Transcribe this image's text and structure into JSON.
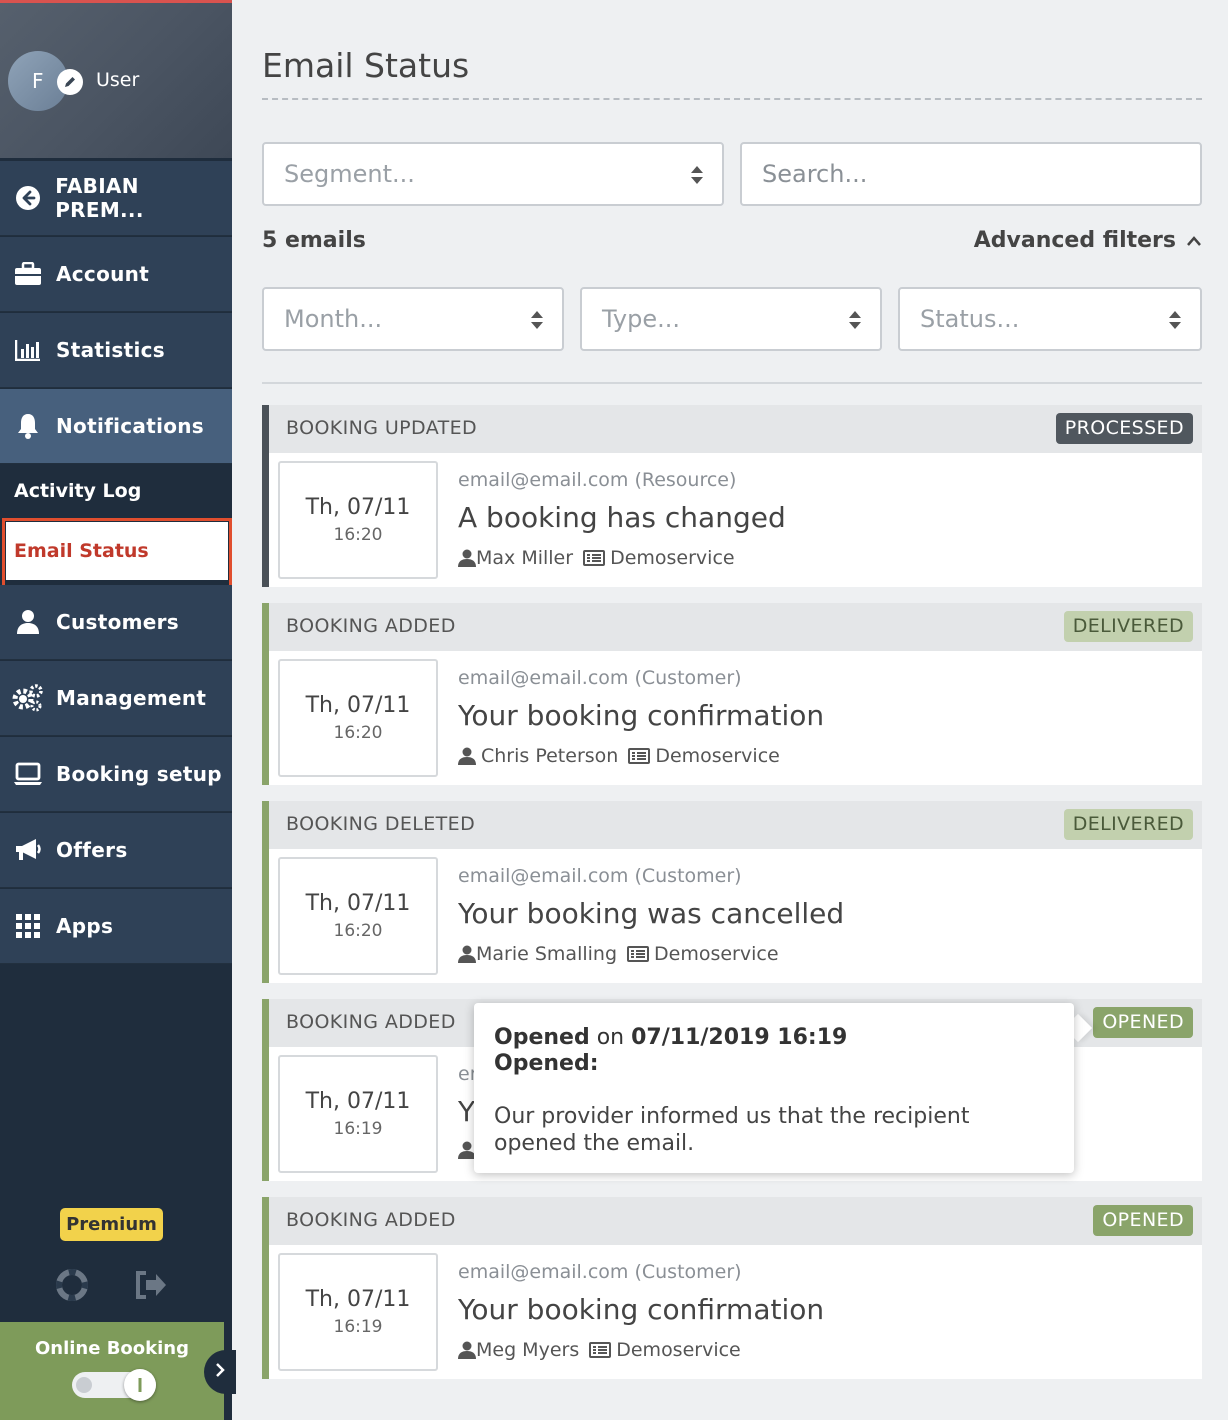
{
  "sidebar": {
    "user": {
      "initial": "F",
      "name": "User"
    },
    "nav": [
      {
        "label": "FABIAN PREM...",
        "icon": "arrow-left-circle-icon"
      },
      {
        "label": "Account",
        "icon": "briefcase-icon"
      },
      {
        "label": "Statistics",
        "icon": "bar-chart-icon"
      },
      {
        "label": "Notifications",
        "icon": "bell-icon",
        "active": true
      },
      {
        "label": "Customers",
        "icon": "user-icon"
      },
      {
        "label": "Management",
        "icon": "gears-icon"
      },
      {
        "label": "Booking setup",
        "icon": "laptop-icon"
      },
      {
        "label": "Offers",
        "icon": "megaphone-icon"
      },
      {
        "label": "Apps",
        "icon": "grid-icon"
      }
    ],
    "subnav": [
      {
        "label": "Activity Log"
      },
      {
        "label": "Email Status",
        "active": true
      }
    ],
    "premium_label": "Premium",
    "online_booking_label": "Online Booking",
    "online_booking_enabled": true
  },
  "main": {
    "title": "Email Status",
    "segment_placeholder": "Segment...",
    "search_placeholder": "Search...",
    "count_label": "5 emails",
    "advanced_filters_label": "Advanced filters",
    "filters": {
      "month_placeholder": "Month...",
      "type_placeholder": "Type...",
      "status_placeholder": "Status..."
    },
    "emails": [
      {
        "type": "BOOKING UPDATED",
        "status": "PROCESSED",
        "day": "Th, 07/11",
        "time": "16:20",
        "recipient": "email@email.com (Resource)",
        "subject": "A booking has changed",
        "person": "Max Miller",
        "service": "Demoservice"
      },
      {
        "type": "BOOKING ADDED",
        "status": "DELIVERED",
        "day": "Th, 07/11",
        "time": "16:20",
        "recipient": "email@email.com (Customer)",
        "subject": "Your booking confirmation",
        "person": "Chris Peterson",
        "service": "Demoservice"
      },
      {
        "type": "BOOKING DELETED",
        "status": "DELIVERED",
        "day": "Th, 07/11",
        "time": "16:20",
        "recipient": "email@email.com (Customer)",
        "subject": "Your booking was cancelled",
        "person": "Marie Smalling",
        "service": "Demoservice"
      },
      {
        "type": "BOOKING ADDED",
        "status": "OPENED",
        "day": "Th, 07/11",
        "time": "16:19",
        "recipient_partial": "er",
        "subject_partial": "Y"
      },
      {
        "type": "BOOKING ADDED",
        "status": "OPENED",
        "day": "Th, 07/11",
        "time": "16:19",
        "recipient": "email@email.com (Customer)",
        "subject": "Your booking confirmation",
        "person": "Meg Myers",
        "service": "Demoservice"
      }
    ],
    "tooltip": {
      "opened_word": "Opened",
      "on_word": "on",
      "opened_at": "07/11/2019 16:19",
      "heading": "Opened:",
      "description": "Our provider informed us that the recipient opened the email."
    }
  },
  "colors": {
    "sidebar_bg": "#1f2d3d",
    "nav_bg": "#2f4157",
    "nav_active_bg": "#47607d",
    "accent_green": "#8aa46a",
    "email_status_red": "#c0392b",
    "premium_yellow": "#f2d24b"
  }
}
